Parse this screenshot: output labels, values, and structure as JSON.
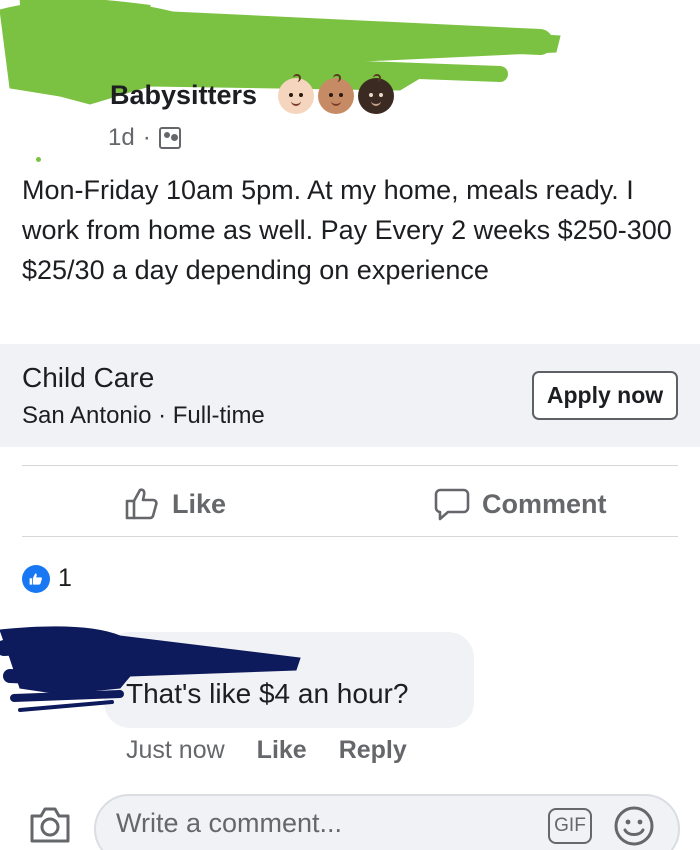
{
  "post": {
    "group_name": "Babysitters",
    "time": "1d",
    "separator": "·",
    "body": "Mon-Friday 10am 5pm. At my home, meals ready. I work from home as well. Pay Every 2 weeks $250-300 $25/30 a day depending on experience",
    "baby_emoji_colors": [
      "#f6d5be",
      "#c68a64",
      "#3b2a22"
    ]
  },
  "job": {
    "title": "Child Care",
    "location": "San Antonio",
    "type": "Full-time",
    "subtitle": "San Antonio · Full-time",
    "apply_label": "Apply now"
  },
  "actions": {
    "like_label": "Like",
    "comment_label": "Comment"
  },
  "reactions": {
    "count": "1",
    "icon": "thumbs-up-icon"
  },
  "comment": {
    "text": "That's like $4 an hour?",
    "time": "Just now",
    "like_label": "Like",
    "reply_label": "Reply"
  },
  "composer": {
    "placeholder": "Write a comment...",
    "gif_label": "GIF"
  },
  "colors": {
    "facebook_blue": "#1877f2",
    "scribble_green": "#7cc242",
    "scribble_navy": "#0d1a5c",
    "secondary_text": "#65676b",
    "card_background": "#f0f2f5"
  }
}
